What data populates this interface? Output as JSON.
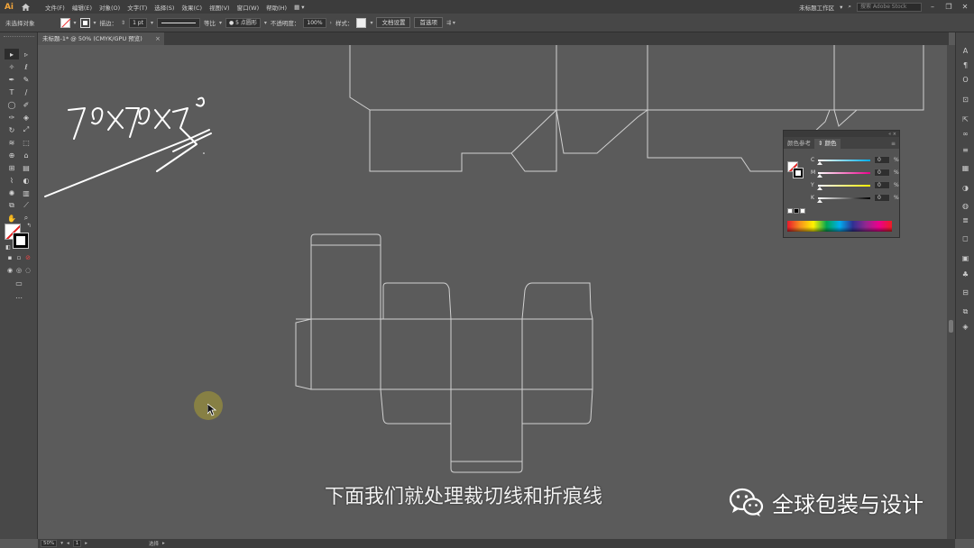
{
  "app": {
    "logo": "Ai"
  },
  "menu": {
    "items": [
      "文件(F)",
      "编辑(E)",
      "对象(O)",
      "文字(T)",
      "选择(S)",
      "效果(C)",
      "视图(V)",
      "窗口(W)",
      "帮助(H)"
    ],
    "workspace": "未标题工作区",
    "search_placeholder": "搜索 Adobe Stock"
  },
  "control_bar": {
    "selection": "未选择对象",
    "stroke_label": "描边：",
    "stroke_weight": "1 pt",
    "stroke_style": "等比",
    "brush": "5 点圆形",
    "opacity_label": "不透明度：",
    "opacity": "100%",
    "style_label": "样式：",
    "doc_setup": "文档设置",
    "preferences": "首选项"
  },
  "document_tab": {
    "title": "未标题-1* @ 50% (CMYK/GPU 预览)"
  },
  "color_panel": {
    "tabs": [
      "颜色参考",
      "颜色"
    ],
    "active_tab": "颜色",
    "channels": [
      {
        "label": "C",
        "value": "0",
        "gradient": "linear-gradient(90deg,#ffffff,#00aeef)"
      },
      {
        "label": "M",
        "value": "0",
        "gradient": "linear-gradient(90deg,#ffffff,#ec008c)"
      },
      {
        "label": "Y",
        "value": "0",
        "gradient": "linear-gradient(90deg,#ffffff,#fff200)"
      },
      {
        "label": "K",
        "value": "0",
        "gradient": "linear-gradient(90deg,#ffffff,#000000)"
      }
    ],
    "unit": "%"
  },
  "status_bar": {
    "zoom": "50%",
    "artboard": "1",
    "tool": "选择"
  },
  "subtitle": "下面我们就处理裁切线和折痕线",
  "watermark": "全球包装与设计",
  "colors": {
    "dieline": "#d0d0d0",
    "canvas": "#5b5b5b",
    "cursor_ring": "#968c3c"
  }
}
